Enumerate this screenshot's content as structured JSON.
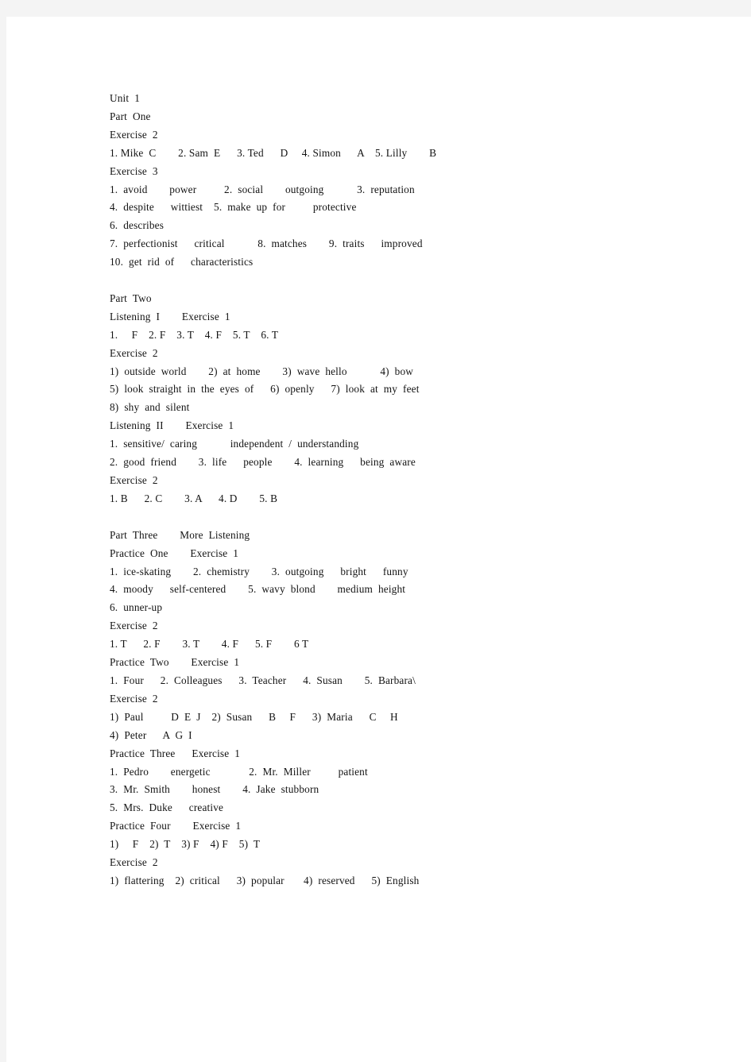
{
  "document": {
    "lines": [
      "Unit  1",
      "Part  One",
      "Exercise  2",
      "1. Mike  C        2. Sam  E      3. Ted      D     4. Simon      A    5. Lilly        B",
      "Exercise  3",
      "1.  avoid        power          2.  social        outgoing            3.  reputation",
      "4.  despite      wittiest    5.  make  up  for          protective",
      "6.  describes",
      "7.  perfectionist      critical            8.  matches        9.  traits      improved",
      "10.  get  rid  of      characteristics",
      "",
      "Part  Two",
      "Listening  I        Exercise  1",
      "1.     F    2. F    3. T    4. F    5. T    6. T",
      "Exercise  2",
      "1)  outside  world        2)  at  home        3)  wave  hello            4)  bow",
      "5)  look  straight  in  the  eyes  of      6)  openly      7)  look  at  my  feet",
      "8)  shy  and  silent",
      "Listening  II        Exercise  1",
      "1.  sensitive/  caring            independent  /  understanding",
      "2.  good  friend        3.  life      people        4.  learning      being  aware",
      "Exercise  2",
      "1. B      2. C        3. A      4. D        5. B",
      "",
      "Part  Three        More  Listening",
      "Practice  One        Exercise  1",
      "1.  ice-skating        2.  chemistry        3.  outgoing      bright      funny",
      "4.  moody      self-centered        5.  wavy  blond        medium  height",
      "6.  unner-up",
      "Exercise  2",
      "1. T      2. F        3. T        4. F      5. F        6 T",
      "Practice  Two        Exercise  1",
      "1.  Four      2.  Colleagues      3.  Teacher      4.  Susan        5.  Barbara\\",
      "Exercise  2",
      "1)  Paul          D  E  J    2)  Susan      B     F      3)  Maria      C     H",
      "4)  Peter      A  G  I",
      "Practice  Three      Exercise  1",
      "1.  Pedro        energetic              2.  Mr.  Miller          patient",
      "3.  Mr.  Smith        honest        4.  Jake  stubborn",
      "5.  Mrs.  Duke      creative",
      "Practice  Four        Exercise  1",
      "1)     F    2)  T    3) F    4) F    5)  T",
      "Exercise  2",
      "1)  flattering    2)  critical      3)  popular       4)  reserved      5)  English"
    ]
  }
}
